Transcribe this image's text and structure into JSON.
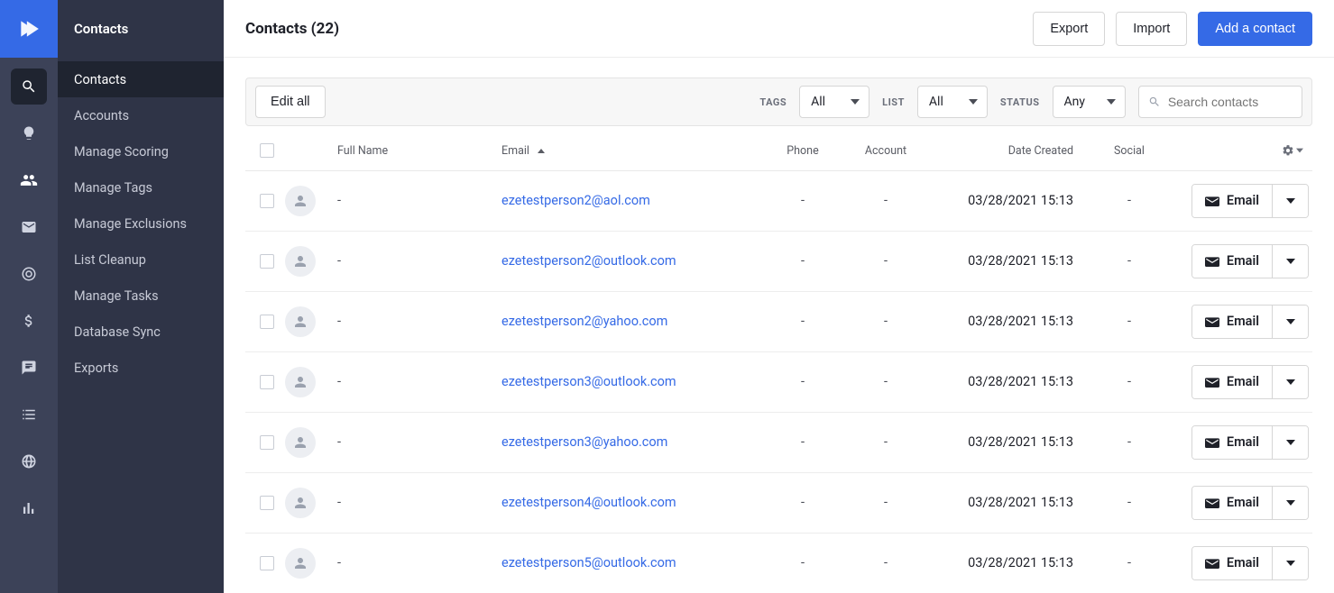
{
  "sidebar": {
    "section_label": "Contacts",
    "items": [
      {
        "label": "Contacts",
        "active": true
      },
      {
        "label": "Accounts",
        "active": false
      },
      {
        "label": "Manage Scoring",
        "active": false
      },
      {
        "label": "Manage Tags",
        "active": false
      },
      {
        "label": "Manage Exclusions",
        "active": false
      },
      {
        "label": "List Cleanup",
        "active": false
      },
      {
        "label": "Manage Tasks",
        "active": false
      },
      {
        "label": "Database Sync",
        "active": false
      },
      {
        "label": "Exports",
        "active": false
      }
    ]
  },
  "header": {
    "title": "Contacts (22)",
    "export_label": "Export",
    "import_label": "Import",
    "add_label": "Add a contact"
  },
  "filters": {
    "edit_all_label": "Edit all",
    "tags_label": "TAGS",
    "tags_value": "All",
    "list_label": "LIST",
    "list_value": "All",
    "status_label": "STATUS",
    "status_value": "Any",
    "search_placeholder": "Search contacts"
  },
  "table": {
    "columns": {
      "full_name": "Full Name",
      "email": "Email",
      "phone": "Phone",
      "account": "Account",
      "date_created": "Date Created",
      "social": "Social"
    },
    "email_button_label": "Email",
    "rows": [
      {
        "full_name": "-",
        "email": "ezetestperson2@aol.com",
        "phone": "-",
        "account": "-",
        "date_created": "03/28/2021 15:13",
        "social": "-"
      },
      {
        "full_name": "-",
        "email": "ezetestperson2@outlook.com",
        "phone": "-",
        "account": "-",
        "date_created": "03/28/2021 15:13",
        "social": "-"
      },
      {
        "full_name": "-",
        "email": "ezetestperson2@yahoo.com",
        "phone": "-",
        "account": "-",
        "date_created": "03/28/2021 15:13",
        "social": "-"
      },
      {
        "full_name": "-",
        "email": "ezetestperson3@outlook.com",
        "phone": "-",
        "account": "-",
        "date_created": "03/28/2021 15:13",
        "social": "-"
      },
      {
        "full_name": "-",
        "email": "ezetestperson3@yahoo.com",
        "phone": "-",
        "account": "-",
        "date_created": "03/28/2021 15:13",
        "social": "-"
      },
      {
        "full_name": "-",
        "email": "ezetestperson4@outlook.com",
        "phone": "-",
        "account": "-",
        "date_created": "03/28/2021 15:13",
        "social": "-"
      },
      {
        "full_name": "-",
        "email": "ezetestperson5@outlook.com",
        "phone": "-",
        "account": "-",
        "date_created": "03/28/2021 15:13",
        "social": "-"
      }
    ]
  }
}
